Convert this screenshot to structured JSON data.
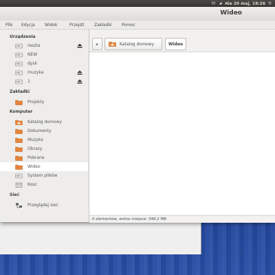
{
  "panel": {
    "clock": "nie 20 maj, 18:26"
  },
  "window": {
    "title": "Wideo"
  },
  "menubar": [
    "Plik",
    "Edycja",
    "Widok",
    "Przejdź",
    "Zakładki",
    "Pomoc"
  ],
  "sidebar": {
    "devices_heading": "Urządzenia",
    "devices": [
      {
        "label": "reszta",
        "icon": "drive-icon",
        "eject": true
      },
      {
        "label": "NEW",
        "icon": "drive-icon",
        "eject": false
      },
      {
        "label": "dysk",
        "icon": "drive-icon",
        "eject": false
      },
      {
        "label": "muzyka",
        "icon": "drive-icon",
        "eject": true
      },
      {
        "label": "1",
        "icon": "drive-icon",
        "eject": true
      }
    ],
    "bookmarks_heading": "Zakładki",
    "bookmarks": [
      {
        "label": "Projekty",
        "icon": "folder-icon"
      }
    ],
    "computer_heading": "Komputer",
    "computer": [
      {
        "label": "Katalog domowy",
        "icon": "home-folder-icon"
      },
      {
        "label": "Dokumenty",
        "icon": "folder-icon"
      },
      {
        "label": "Muzyka",
        "icon": "folder-icon"
      },
      {
        "label": "Obrazy",
        "icon": "folder-icon"
      },
      {
        "label": "Pobrane",
        "icon": "folder-icon"
      },
      {
        "label": "Wideo",
        "icon": "folder-icon",
        "selected": true
      },
      {
        "label": "System plików",
        "icon": "drive-icon"
      },
      {
        "label": "Kosz",
        "icon": "trash-icon"
      }
    ],
    "network_heading": "Sieć",
    "network": [
      {
        "label": "Przeglądaj sieć",
        "icon": "network-icon"
      }
    ]
  },
  "pathbar": {
    "back_glyph": "◂",
    "home_label": "Katalog domowy",
    "current_label": "Wideo"
  },
  "status": "0 elementów, wolne miejsce: 348,2 MB",
  "colors": {
    "folder": "#e8843a",
    "selection": "#ffffff",
    "desktop": "#2c4fa8"
  }
}
